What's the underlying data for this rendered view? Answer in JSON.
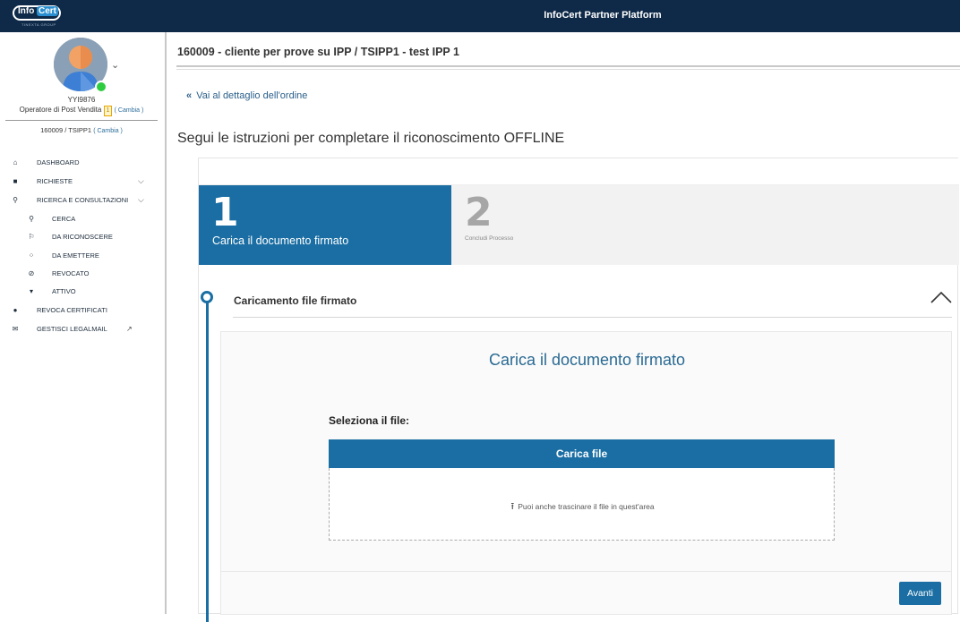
{
  "header": {
    "logo_text_info": "Info",
    "logo_text_cert": "Cert",
    "logo_subtext": "TINEXTA GROUP",
    "app_title": "InfoCert Partner Platform"
  },
  "user": {
    "code": "YYI9876",
    "role": "Operatore di Post Vendita",
    "role_badge": "1",
    "change_role": "( Cambia )",
    "org": "160009 / TSIPP1",
    "change_org": "( Cambia )"
  },
  "sidebar": {
    "items": [
      {
        "label": "DASHBOARD",
        "icon": "home-icon"
      },
      {
        "label": "RICHIESTE",
        "icon": "briefcase-icon"
      },
      {
        "label": "RICERCA E CONSULTAZIONI",
        "icon": "search-icon"
      },
      {
        "label": "CERCA",
        "icon": "search-icon"
      },
      {
        "label": "DA RICONOSCERE",
        "icon": "pin-icon"
      },
      {
        "label": "DA EMETTERE",
        "icon": "spinner-icon"
      },
      {
        "label": "REVOCATO",
        "icon": "ban-icon"
      },
      {
        "label": "ATTIVO",
        "icon": "shield-icon"
      },
      {
        "label": "REVOCA CERTIFICATI",
        "icon": "circle-icon"
      },
      {
        "label": "GESTISCI LEGALMAIL",
        "icon": "mail-icon"
      }
    ]
  },
  "main": {
    "title": "160009 - cliente per prove su IPP  / TSIPP1 - test IPP 1",
    "back_link": "Vai al dettaglio dell'ordine",
    "back_icon": "«",
    "heading": "Segui le istruzioni per completare il riconoscimento OFFLINE"
  },
  "wizard": {
    "steps": [
      {
        "number": "1",
        "label": "Carica il documento firmato",
        "active": true
      },
      {
        "number": "2",
        "label": "Concludi Processo",
        "active": false
      }
    ],
    "section_title": "Caricamento file firmato",
    "panel_title": "Carica il documento firmato",
    "file_label": "Seleziona il file:",
    "upload_button": "Carica file",
    "drop_hint": "Puoi anche trascinare il file in quest'area",
    "next_button": "Avanti"
  },
  "colors": {
    "topbar": "#0f2a48",
    "primary": "#1a6ea3",
    "online": "#2ecc40"
  }
}
